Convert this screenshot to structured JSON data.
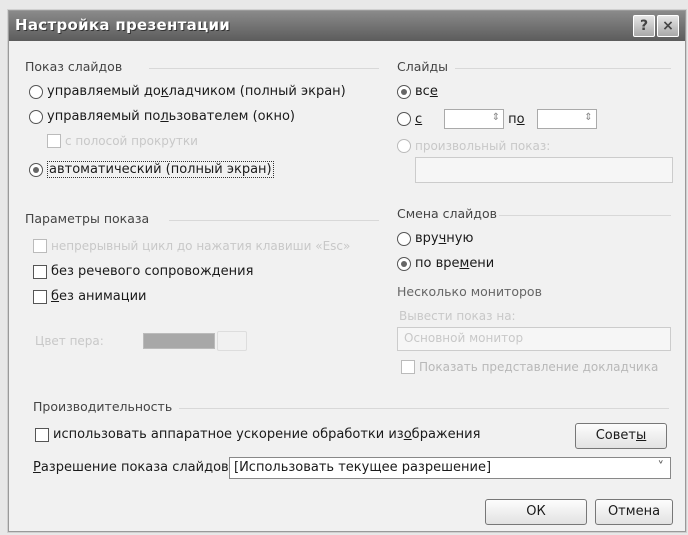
{
  "window": {
    "title": "Настройка презентации",
    "help_icon": "?",
    "close_icon": "×"
  },
  "show_type": {
    "group_label": "Показ слайдов",
    "presenter_prefix": "управляемый до",
    "presenter_key": "к",
    "presenter_suffix": "ладчиком (полный экран)",
    "individual_prefix": "управляемый по",
    "individual_key": "л",
    "individual_suffix": "ьзователем (окно)",
    "scrollbar_label": "с полосой прокрутки",
    "kiosk_label": "автоматический (полный экран)",
    "selected": "kiosk"
  },
  "show_options": {
    "group_label": "Параметры показа",
    "loop_label": "непрерывный цикл до нажатия клавиши «Esc»",
    "narration_prefix": "без речевого сопровож",
    "narration_key": "д",
    "narration_suffix": "ения",
    "animation_key": "б",
    "animation_suffix": "ез анимации",
    "pen_color_label": "Цвет пера:"
  },
  "slides": {
    "group_label": "Слайды",
    "all_prefix": "вс",
    "all_key": "е",
    "from_key": "с",
    "to_prefix": "п",
    "to_key": "о",
    "custom_show_label": "произвольный показ:",
    "selected": "all"
  },
  "advance": {
    "group_label": "Смена слайдов",
    "manual_prefix": "вру",
    "manual_key": "ч",
    "manual_suffix": "ную",
    "timings_prefix": "по вре",
    "timings_key": "м",
    "timings_suffix": "ени",
    "selected": "timings"
  },
  "monitors": {
    "group_label": "Несколько мониторов",
    "display_label": "Вывести показ на:",
    "display_value": "Основной монитор",
    "presenter_view_label": "Показать представление докладчика"
  },
  "performance": {
    "group_label": "Производительность",
    "hw_accel_prefix": "использовать аппаратное ускорение обработки из",
    "hw_accel_key": "о",
    "hw_accel_suffix": "бражения",
    "tips_prefix": "Совет",
    "tips_key": "ы",
    "resolution_key": "Р",
    "resolution_label_suffix": "азрешение показа слайдов:",
    "resolution_value": "[Использовать текущее разрешение]",
    "chevron": "˅"
  },
  "buttons": {
    "ok": "ОК",
    "cancel": "Отмена"
  },
  "colors": {
    "titlebar": "#6e6e6e",
    "background": "#f1f1f1"
  }
}
